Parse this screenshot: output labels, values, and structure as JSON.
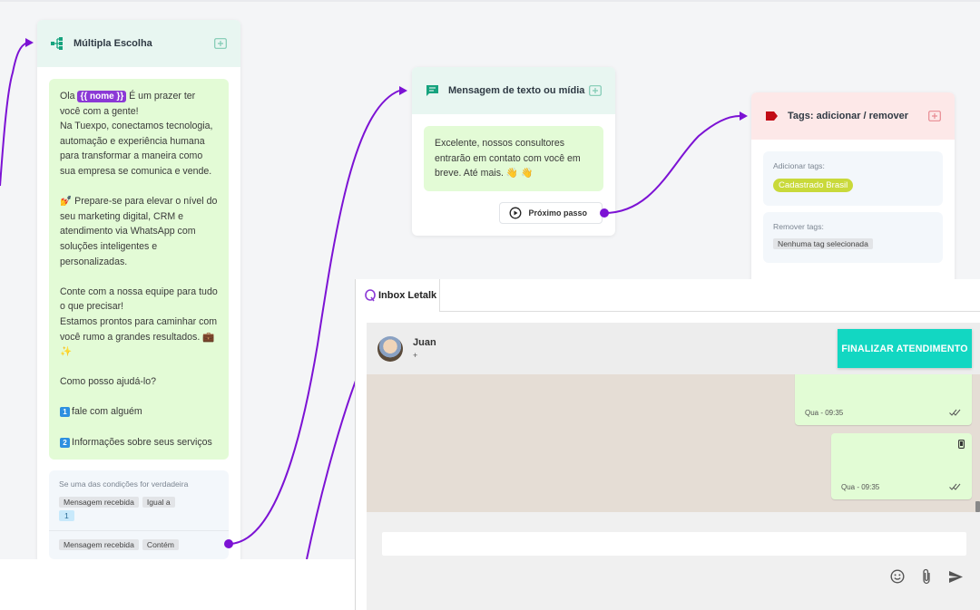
{
  "flow": {
    "multiple_choice": {
      "title": "Múltipla Escolha",
      "message": {
        "greeting_before": "Ola ",
        "variable": "{{ nome }}",
        "greeting_after": " É um prazer ter você com a gente!",
        "p1": "Na Tuexpo, conectamos tecnologia, automação e experiência humana para transformar a maneira como sua empresa se comunica e vende.",
        "p2": "💅 Prepare-se para elevar o nível do seu marketing digital, CRM e atendimento via WhatsApp com soluções inteligentes e personalizadas.",
        "p3a": "Conte com a nossa equipe para tudo o que precisar!",
        "p3b": "Estamos prontos para caminhar com você rumo a grandes resultados. 💼 ✨",
        "p4": "Como posso ajudá-lo?",
        "option1_key": "1",
        "option1": "fale com alguém",
        "option2_key": "2",
        "option2": "Informações sobre seus serviços"
      },
      "conditions": {
        "label": "Se uma das condições for verdadeira",
        "row1": {
          "field": "Mensagem recebida",
          "operator": "Igual a",
          "value": "1"
        },
        "row2": {
          "field": "Mensagem recebida",
          "operator": "Contém"
        }
      }
    },
    "text_message": {
      "title": "Mensagem de texto ou mídia",
      "message": "Excelente, nossos consultores entrarão em contato com você em breve. Até mais. 👋 👋",
      "next_step_label": "Próximo passo"
    },
    "tags": {
      "title": "Tags: adicionar / remover",
      "add_label": "Adicionar tags:",
      "add_tag": "Cadastrado Brasil",
      "remove_label": "Remover tags:",
      "remove_tag": "Nenhuma tag selecionada"
    }
  },
  "inbox": {
    "tab_label": "Inbox Letalk",
    "contact_name": "Juan",
    "contact_phone": "+",
    "finish_button": "FINALIZAR ATENDIMENTO",
    "messages": [
      {
        "time": "Qua - 09:35"
      },
      {
        "time": "Qua - 09:35"
      }
    ],
    "input_placeholder": ""
  },
  "colors": {
    "node_header_green": "#e8f6f1",
    "node_header_red": "#fde8e8",
    "message_bg": "#e3fbd6",
    "connector_purple": "#7c12d4",
    "variable_chip": "#8b39d6",
    "finish_button": "#12d7c2",
    "tag_green": "#c9d93a"
  }
}
